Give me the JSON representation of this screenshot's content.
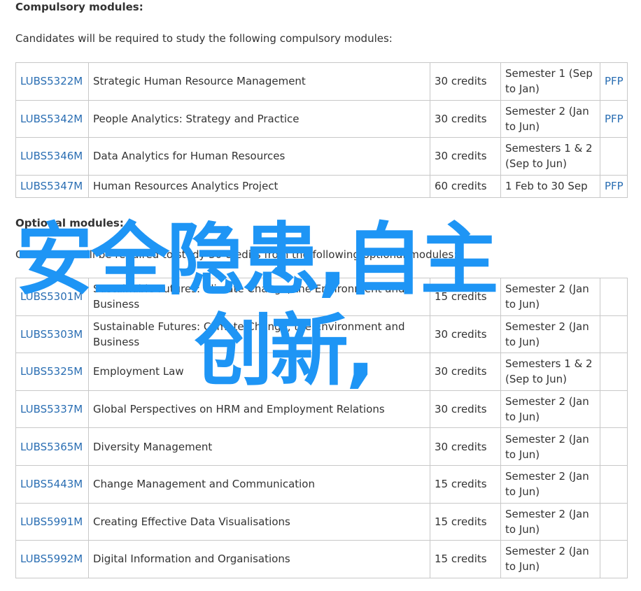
{
  "compulsory": {
    "heading": "Compulsory modules:",
    "intro": "Candidates will be required to study the following compulsory modules:",
    "rows": [
      {
        "code": "LUBS5322M",
        "title": "Strategic Human Resource Management",
        "credits": "30 credits",
        "semester": "Semester 1 (Sep to Jan)",
        "pfp": "PFP"
      },
      {
        "code": "LUBS5342M",
        "title": "People Analytics: Strategy and Practice",
        "credits": "30 credits",
        "semester": "Semester 2 (Jan to Jun)",
        "pfp": "PFP"
      },
      {
        "code": "LUBS5346M",
        "title": "Data Analytics for Human Resources",
        "credits": "30 credits",
        "semester": "Semesters 1 & 2 (Sep to Jun)",
        "pfp": ""
      },
      {
        "code": "LUBS5347M",
        "title": "Human Resources Analytics Project",
        "credits": "60 credits",
        "semester": "1 Feb to 30 Sep",
        "pfp": "PFP"
      }
    ]
  },
  "optional": {
    "heading": "Optional modules:",
    "intro": "Candidates will be required to study 30 credits from the following optional modules:",
    "rows": [
      {
        "code": "LUBS5301M",
        "title": "Sustainable Futures: Climate Change, the Environment and Business",
        "credits": "15 credits",
        "semester": "Semester 2 (Jan to Jun)",
        "pfp": ""
      },
      {
        "code": "LUBS5303M",
        "title": "Sustainable Futures: Climate Change, the Environment and Business",
        "credits": "30 credits",
        "semester": "Semester 2 (Jan to Jun)",
        "pfp": ""
      },
      {
        "code": "LUBS5325M",
        "title": "Employment Law",
        "credits": "30 credits",
        "semester": "Semesters 1 & 2 (Sep to Jun)",
        "pfp": ""
      },
      {
        "code": "LUBS5337M",
        "title": "Global Perspectives on HRM and Employment Relations",
        "credits": "30 credits",
        "semester": "Semester 2 (Jan to Jun)",
        "pfp": ""
      },
      {
        "code": "LUBS5365M",
        "title": "Diversity Management",
        "credits": "30 credits",
        "semester": "Semester 2 (Jan to Jun)",
        "pfp": ""
      },
      {
        "code": "LUBS5443M",
        "title": "Change Management and Communication",
        "credits": "15 credits",
        "semester": "Semester 2 (Jan to Jun)",
        "pfp": ""
      },
      {
        "code": "LUBS5991M",
        "title": "Creating Effective Data Visualisations",
        "credits": "15 credits",
        "semester": "Semester 2 (Jan to Jun)",
        "pfp": ""
      },
      {
        "code": "LUBS5992M",
        "title": "Digital Information and Organisations",
        "credits": "15 credits",
        "semester": "Semester 2 (Jan to Jun)",
        "pfp": ""
      }
    ]
  },
  "watermark": {
    "line1": "安全隐患,自主",
    "line2": "创新,",
    "color": "#1e95f5"
  }
}
